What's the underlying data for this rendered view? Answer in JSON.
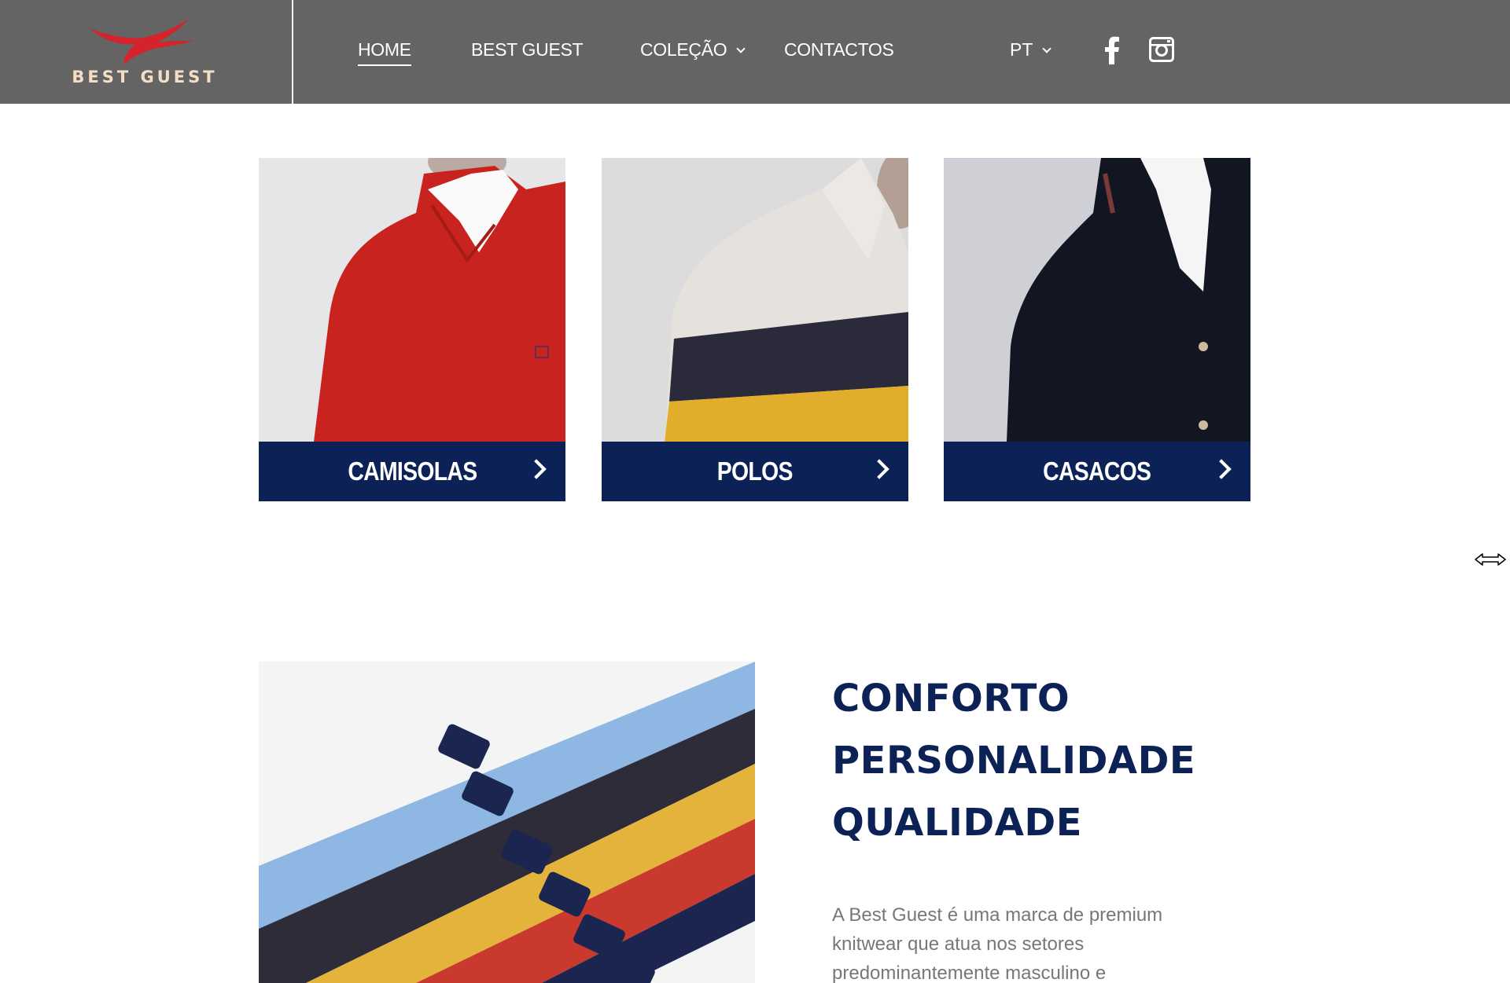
{
  "header": {
    "logo_text": "BEST GUEST",
    "nav": {
      "home": "HOME",
      "best_guest": "BEST GUEST",
      "colecao": "COLEÇÃO",
      "contactos": "CONTACTOS"
    },
    "language": "PT",
    "icons": [
      "facebook-icon",
      "instagram-icon",
      "chevron-down-icon"
    ]
  },
  "categories": [
    {
      "label": "CAMISOLAS"
    },
    {
      "label": "POLOS"
    },
    {
      "label": "CASACOS"
    }
  ],
  "about": {
    "headline": [
      "CONFORTO",
      "PERSONALIDADE",
      "QUALIDADE"
    ],
    "intro": "A Best Guest é uma marca de premium knitwear que atua nos setores predominantemente masculino e"
  },
  "colors": {
    "header_bg": "#646464",
    "brand_navy": "#0c2257",
    "logo_red": "#d6222a",
    "text_gray": "#777777"
  }
}
